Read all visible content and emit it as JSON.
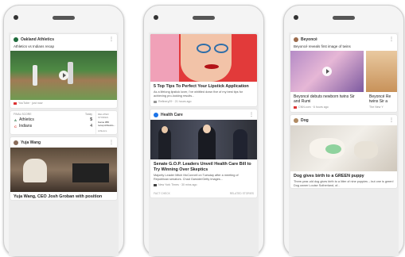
{
  "phone1": {
    "card1": {
      "source": "Oakland Athletics",
      "subtitle": "Athletics vs Indians recap",
      "meta": "YouTube · just now"
    },
    "score": {
      "header_left": "FINAL SCORE",
      "header_right": "Today",
      "team1": "Athletics",
      "team1_score": "5",
      "team2": "Indians",
      "team2_score": "4",
      "side_label": "RELATED STORIES",
      "side_text": "Game #80 recap Athletics...",
      "side_source": "Athletics"
    },
    "card2": {
      "source": "Yuja Wang",
      "title": "Yuja Wang, CEO Josh Groban with position"
    }
  },
  "phone2": {
    "card1": {
      "title": "5 Top Tips To Perfect Your Lipstick Application",
      "desc": "As a lifelong lipstick lover, I've whittled down five of my best tips for achieving pro-looking results...",
      "meta": "Refinery29 · 21 hours ago"
    },
    "card2": {
      "source": "Health Care",
      "title": "Senate G.O.P. Leaders Unveil Health Care Bill to Try Winning Over Skeptics",
      "desc": "Majority Leader Mitch McConnell on Tuesday after a meeting of Republican senators. Chad Garside/Getty Images...",
      "meta": "New York Times · 30 mins ago",
      "foot_left": "FACT CHECK",
      "foot_right": "RELATED STORIES"
    }
  },
  "phone3": {
    "card1": {
      "source": "Beyoncé",
      "subtitle": "Beyoncé reveals first image of twins",
      "item1_title": "Beyoncé debuts newborn twins Sir and Rumi",
      "item1_meta": "CNN.com · 6 hours ago",
      "item2_title": "Beyoncé Re twins Sir a",
      "item2_meta": "The New Y"
    },
    "card2": {
      "source": "Dog",
      "title": "Dog gives birth to a GREEN puppy",
      "desc": "Three-year-old dog gives birth to a litter of nine puppies – but one is green! Dog owner Louise Sutherland, of..."
    }
  },
  "colors": {
    "red": "#d93025",
    "navy": "#0b2a57",
    "green": "#1e6b3b"
  }
}
